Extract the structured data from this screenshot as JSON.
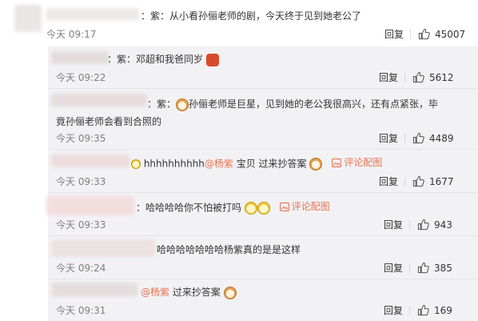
{
  "colors": {
    "accent": "#eb7350",
    "link": "#4a7ec6",
    "time": "#808080",
    "subpanel_bg": "#f2f2f5"
  },
  "main_comment": {
    "text": "：紫：从小看孙俪老师的剧，今天终于见到她老公了",
    "time": "今天 09:17",
    "reply": "回复",
    "likes": "45007"
  },
  "replies": [
    {
      "text": "：紫：邓超和我爸同岁",
      "emoji": "red-envelope-icon",
      "time": "今天 09:22",
      "reply": "回复",
      "likes": "5612"
    },
    {
      "text_prefix": "：紫：",
      "text_main": "孙俪老师是巨星，见到她的老公我很高兴，还有点紧张，毕竟孙俪老师会看到合照的",
      "emoji": "cat-face-icon",
      "time": "今天 09:35",
      "reply": "回复",
      "likes": "4489"
    },
    {
      "text_prefix": "hhhhhhhhhh",
      "mention": "@杨紫",
      "text_after": " 宝贝 过来抄答案",
      "pic_link": "评论配图",
      "time": "今天 09:33",
      "reply": "回复",
      "likes": "1677"
    },
    {
      "text": "：哈哈哈哈你不怕被打吗",
      "emoji": "doge-icon",
      "pic_link": "评论配图",
      "time": "今天 09:33",
      "reply": "回复",
      "likes": "943"
    },
    {
      "text": "哈哈哈哈哈哈哈杨紫真的是是这样",
      "time": "今天 09:24",
      "reply": "回复",
      "likes": "385"
    },
    {
      "mention": "@杨紫",
      "text_after": " 过来抄答案",
      "emoji": "cat-face-icon",
      "time": "今天 09:31",
      "reply": "回复",
      "likes": "169"
    }
  ]
}
